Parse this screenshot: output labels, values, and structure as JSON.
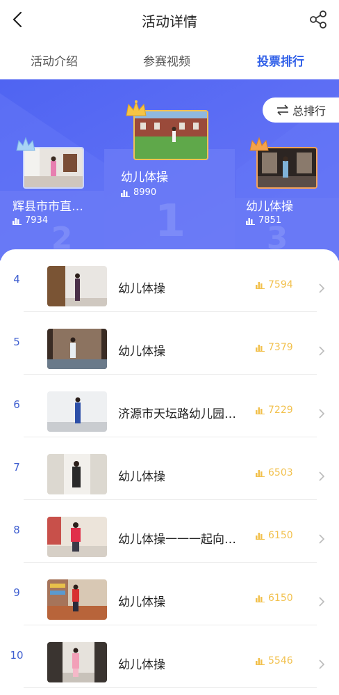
{
  "header": {
    "title": "活动详情",
    "back_icon": "back-chevron-icon",
    "share_icon": "share-icon"
  },
  "tabs": [
    {
      "label": "活动介绍",
      "active": false
    },
    {
      "label": "参赛视频",
      "active": false
    },
    {
      "label": "投票排行",
      "active": true
    }
  ],
  "colors": {
    "accent": "#2f5fe8",
    "hero_bg": "#5b6df4",
    "vote_gold": "#f2c14e",
    "rank_blue": "#3f5fd0"
  },
  "podium": {
    "total_button": {
      "label": "总排行",
      "icon": "swap-icon"
    },
    "first": {
      "rank": "1",
      "name": "幼儿体操",
      "votes": "8990"
    },
    "second": {
      "rank": "2",
      "name": "辉县市市直…",
      "votes": "7934"
    },
    "third": {
      "rank": "3",
      "name": "幼儿体操",
      "votes": "7851"
    }
  },
  "ranking": [
    {
      "rank": "4",
      "name": "幼儿体操",
      "votes": "7594"
    },
    {
      "rank": "5",
      "name": "幼儿体操",
      "votes": "7379"
    },
    {
      "rank": "6",
      "name": "济源市天坛路幼儿园…",
      "votes": "7229"
    },
    {
      "rank": "7",
      "name": "幼儿体操",
      "votes": "6503"
    },
    {
      "rank": "8",
      "name": "幼儿体操一一一起向…",
      "votes": "6150"
    },
    {
      "rank": "9",
      "name": "幼儿体操",
      "votes": "6150"
    },
    {
      "rank": "10",
      "name": "幼儿体操",
      "votes": "5546"
    }
  ]
}
